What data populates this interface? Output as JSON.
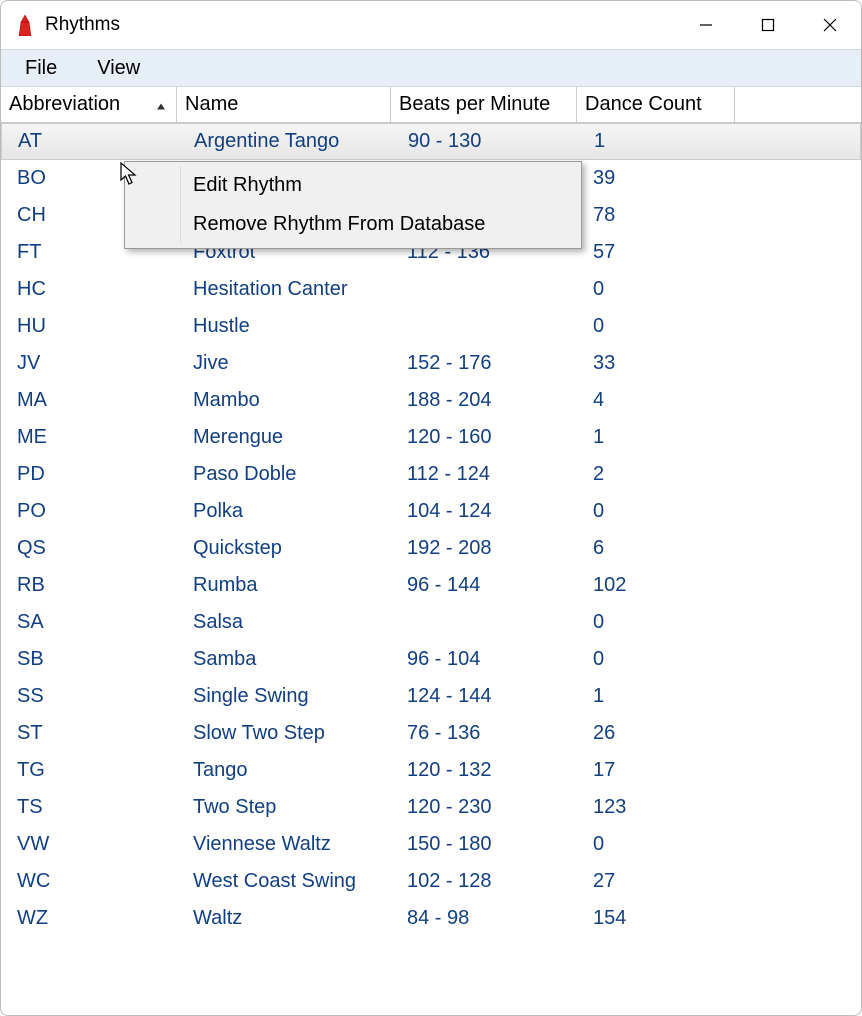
{
  "window": {
    "title": "Rhythms"
  },
  "menu": {
    "file": "File",
    "view": "View"
  },
  "columns": {
    "abbrev": "Abbreviation",
    "name": "Name",
    "bpm": "Beats per Minute",
    "count": "Dance Count"
  },
  "rows": [
    {
      "abbrev": "AT",
      "name": "Argentine Tango",
      "bpm": "90 - 130",
      "count": "1"
    },
    {
      "abbrev": "BO",
      "name": "",
      "bpm": "",
      "count": "39"
    },
    {
      "abbrev": "CH",
      "name": "",
      "bpm": "",
      "count": "78"
    },
    {
      "abbrev": "FT",
      "name": "Foxtrot",
      "bpm": "112 - 136",
      "count": "57"
    },
    {
      "abbrev": "HC",
      "name": "Hesitation Canter",
      "bpm": "",
      "count": "0"
    },
    {
      "abbrev": "HU",
      "name": "Hustle",
      "bpm": "",
      "count": "0"
    },
    {
      "abbrev": "JV",
      "name": "Jive",
      "bpm": "152 - 176",
      "count": "33"
    },
    {
      "abbrev": "MA",
      "name": "Mambo",
      "bpm": "188 - 204",
      "count": "4"
    },
    {
      "abbrev": "ME",
      "name": "Merengue",
      "bpm": "120 - 160",
      "count": "1"
    },
    {
      "abbrev": "PD",
      "name": "Paso Doble",
      "bpm": "112 - 124",
      "count": "2"
    },
    {
      "abbrev": "PO",
      "name": "Polka",
      "bpm": "104 - 124",
      "count": "0"
    },
    {
      "abbrev": "QS",
      "name": "Quickstep",
      "bpm": "192 - 208",
      "count": "6"
    },
    {
      "abbrev": "RB",
      "name": "Rumba",
      "bpm": "96 - 144",
      "count": "102"
    },
    {
      "abbrev": "SA",
      "name": "Salsa",
      "bpm": "",
      "count": "0"
    },
    {
      "abbrev": "SB",
      "name": "Samba",
      "bpm": "96 - 104",
      "count": "0"
    },
    {
      "abbrev": "SS",
      "name": "Single Swing",
      "bpm": "124 - 144",
      "count": "1"
    },
    {
      "abbrev": "ST",
      "name": "Slow Two Step",
      "bpm": "76 - 136",
      "count": "26"
    },
    {
      "abbrev": "TG",
      "name": "Tango",
      "bpm": "120 - 132",
      "count": "17"
    },
    {
      "abbrev": "TS",
      "name": "Two Step",
      "bpm": "120 - 230",
      "count": "123"
    },
    {
      "abbrev": "VW",
      "name": "Viennese Waltz",
      "bpm": "150 - 180",
      "count": "0"
    },
    {
      "abbrev": "WC",
      "name": "West Coast Swing",
      "bpm": "102 - 128",
      "count": "27"
    },
    {
      "abbrev": "WZ",
      "name": "Waltz",
      "bpm": "84 - 98",
      "count": "154"
    }
  ],
  "contextMenu": {
    "edit": "Edit Rhythm",
    "remove": "Remove Rhythm From Database"
  }
}
